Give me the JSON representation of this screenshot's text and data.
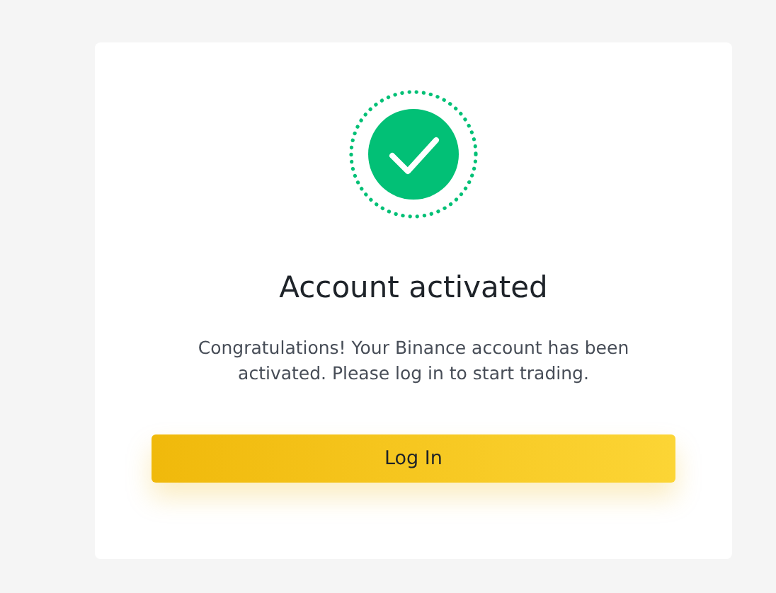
{
  "card": {
    "title": "Account activated",
    "message": "Congratulations! Your Binance account has been activated. Please log in to start trading.",
    "button": "Log In"
  }
}
